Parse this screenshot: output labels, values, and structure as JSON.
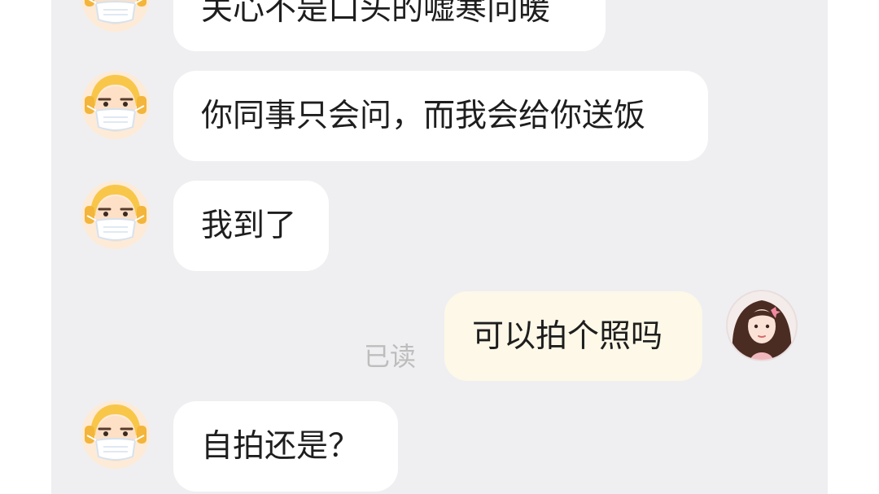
{
  "messages": [
    {
      "side": "left",
      "text": "关心不是口头的嘘寒问暖"
    },
    {
      "side": "left",
      "text": "你同事只会问，而我会给你送饭"
    },
    {
      "side": "left",
      "text": "我到了"
    },
    {
      "side": "right",
      "text": "可以拍个照吗",
      "status": "已读"
    },
    {
      "side": "left",
      "text": "自拍还是？"
    }
  ],
  "colors": {
    "background": "#efeff1",
    "incoming_bubble": "#ffffff",
    "outgoing_bubble": "#fdf8e8",
    "text": "#1e1e1e",
    "read_status": "#bdbdbd"
  },
  "icons": {
    "contact_avatar": "masked-courier-avatar-icon",
    "self_avatar": "girl-portrait-avatar-icon"
  }
}
